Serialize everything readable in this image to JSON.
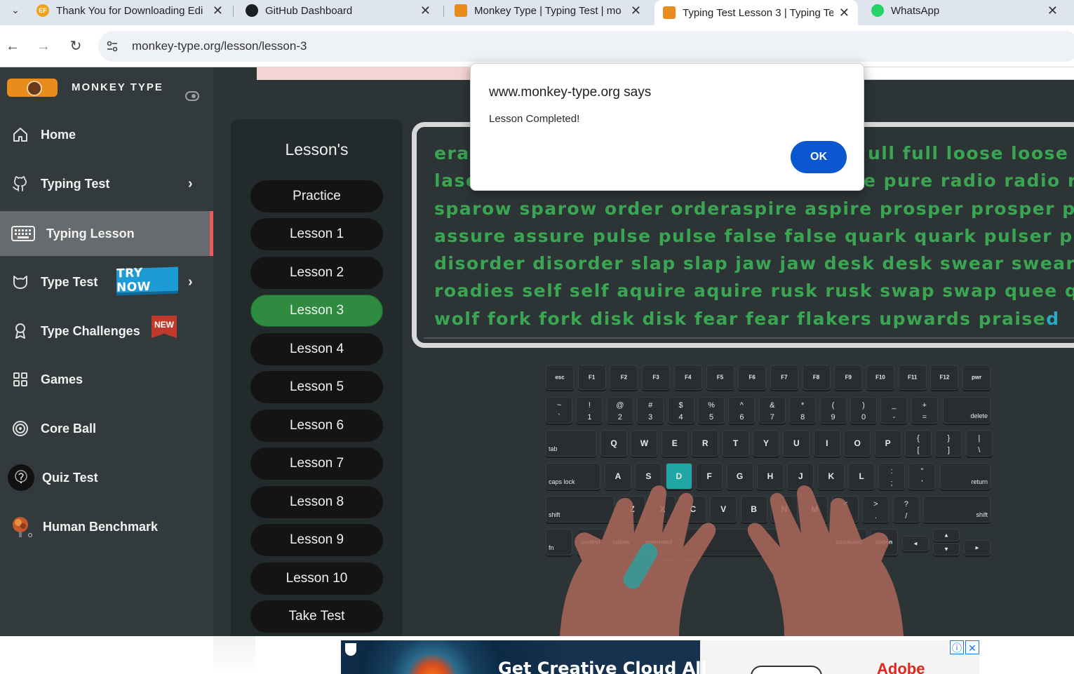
{
  "browser": {
    "tabs": [
      {
        "title": "Thank You for Downloading Edi",
        "favicon": "ef-icon",
        "active": false
      },
      {
        "title": "GitHub Dashboard",
        "favicon": "github-icon",
        "active": false
      },
      {
        "title": "Monkey Type | Typing Test | mo",
        "favicon": "monkeytype-icon",
        "active": false
      },
      {
        "title": "Typing Test Lesson 3 | Typing Te",
        "favicon": "monkeytype-icon",
        "active": true
      },
      {
        "title": "WhatsApp",
        "favicon": "whatsapp-icon",
        "active": false
      }
    ],
    "favicon_text": {
      "ef": "EF"
    },
    "url": "monkey-type.org/lesson/lesson-3"
  },
  "sidebar": {
    "brand": "MONKEY TYPE",
    "items": [
      {
        "label": "Home",
        "icon": "home-icon"
      },
      {
        "label": "Typing Test",
        "icon": "github-icon",
        "has_chevron": true
      },
      {
        "label": "Typing Lesson",
        "icon": "keyboard-icon",
        "active": true
      },
      {
        "label": "Type Test",
        "icon": "cat-icon",
        "has_chevron": true,
        "badge": "TRY NOW"
      },
      {
        "label": "Type Challenges",
        "icon": "award-icon",
        "badge": "NEW"
      },
      {
        "label": "Games",
        "icon": "grid-icon"
      },
      {
        "label": "Core Ball",
        "icon": "target-icon"
      },
      {
        "label": "Quiz Test",
        "icon": "quiz-avatar-icon"
      },
      {
        "label": "Human Benchmark",
        "icon": "brain-icon"
      }
    ]
  },
  "lessons": {
    "title": "Lesson's",
    "items": [
      "Practice",
      "Lesson 1",
      "Lesson 2",
      "Lesson 3",
      "Lesson 4",
      "Lesson 5",
      "Lesson 6",
      "Lesson 7",
      "Lesson 8",
      "Lesson 9",
      "Lesson 10",
      "Take Test"
    ],
    "active_index": 3
  },
  "typing_text": {
    "lines": [
      "era",
      "lase",
      "sparow sparow order orderaspire aspire prosper prosper peris pe",
      "assure assure pulse pulse false false quark quark pulser pul",
      "disorder disorder slap slap jaw jaw desk desk swear swear road",
      "roadies self self aquire aquire rusk rusk swap swap quee quee w",
      "wolf fork fork disk disk fear fear flakers upwards praise"
    ],
    "line1_right": "ull full loose loose loo",
    "line2_right": "e pure radio radio ra",
    "cursor_char": "d",
    "colors": {
      "typed": "#3aa652",
      "cursor": "#28a9c7"
    }
  },
  "keyboard": {
    "highlight_key": "D",
    "rows": {
      "fn": [
        "esc",
        "F1",
        "F2",
        "F3",
        "F4",
        "F5",
        "F6",
        "F7",
        "F8",
        "F9",
        "F10",
        "F11",
        "F12",
        "pwr"
      ],
      "num_top": [
        "~",
        "!",
        "@",
        "#",
        "$",
        "%",
        "^",
        "&",
        "*",
        "(",
        ")",
        "_",
        "+"
      ],
      "num_bot": [
        "`",
        "1",
        "2",
        "3",
        "4",
        "5",
        "6",
        "7",
        "8",
        "9",
        "0",
        "-",
        "="
      ],
      "delete": "delete",
      "tab": "tab",
      "q": [
        "Q",
        "W",
        "E",
        "R",
        "T",
        "Y",
        "U",
        "I",
        "O",
        "P"
      ],
      "q_sym_top": [
        "{",
        "}",
        "|"
      ],
      "q_sym_bot": [
        "[",
        "]",
        "\\"
      ],
      "caps": "caps lock",
      "a": [
        "A",
        "S",
        "D",
        "F",
        "G",
        "H",
        "J",
        "K",
        "L"
      ],
      "a_sym_top": [
        ":",
        "\""
      ],
      "a_sym_bot": [
        ";",
        "'"
      ],
      "return": "return",
      "shift": "shift",
      "z": [
        "Z",
        "X",
        "C",
        "V",
        "B",
        "N",
        "M"
      ],
      "z_sym_top": [
        "<",
        ">",
        "?"
      ],
      "z_sym_bot": [
        ",",
        ".",
        "/"
      ],
      "bottom": [
        "fn",
        "control",
        "option",
        "command",
        "command",
        "option"
      ],
      "arrows": [
        "▲",
        "▼",
        "◄",
        "►"
      ]
    }
  },
  "dialog": {
    "title": "www.monkey-type.org says",
    "message": "Lesson Completed!",
    "ok": "OK"
  },
  "ad_bottom": {
    "headline": "Get Creative Cloud All",
    "brand": "Adobe",
    "info": "ⓘ",
    "close": "✕"
  }
}
